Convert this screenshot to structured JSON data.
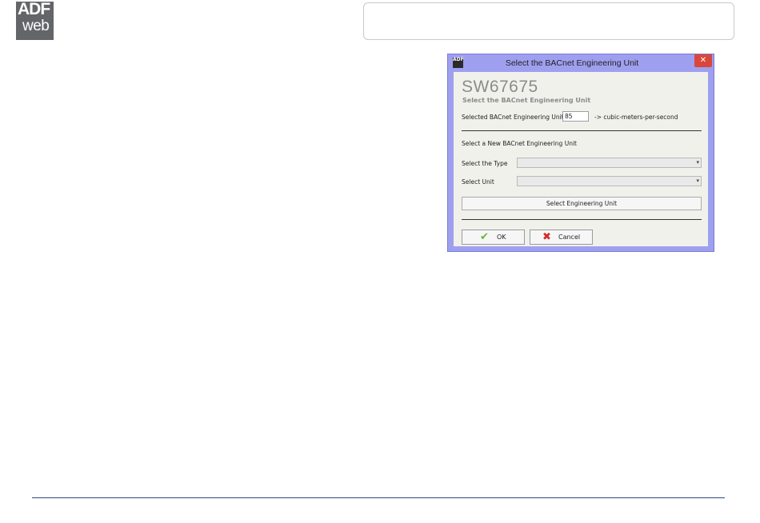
{
  "logo": {
    "line1": "ADF",
    "line2": "web"
  },
  "dialog": {
    "app_icon_text": "ADF",
    "title": "Select the BACnet Engineering Unit",
    "close_glyph": "✕",
    "product": "SW67675",
    "subtitle": "Select the BACnet Engineering Unit",
    "selected_label": "Selected BACnet Engineering Unit",
    "selected_value": "85",
    "selected_unit_text": "-> cubic-meters-per-second",
    "new_unit_heading": "Select a New BACnet Engineering Unit",
    "type_label": "Select the Type",
    "type_value": "",
    "unit_label": "Select Unit",
    "unit_value": "",
    "select_button": "Select Engineering Unit",
    "ok_button": "OK",
    "cancel_button": "Cancel"
  },
  "icons": {
    "ok": "check-icon",
    "cancel": "cross-icon",
    "dropdown": "chevron-down-icon"
  },
  "colors": {
    "dialog_frame": "#9f9ff0",
    "close": "#d9473b",
    "footer_line": "#2b4b75"
  }
}
